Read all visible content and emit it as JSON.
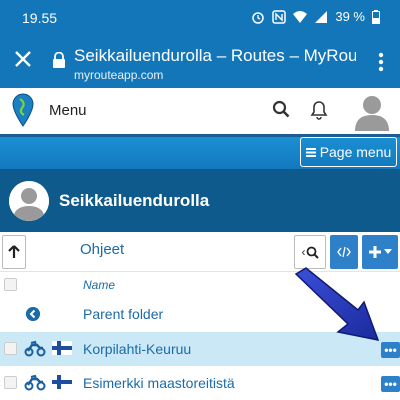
{
  "status_bar": {
    "time": "19.55",
    "battery": "39 %",
    "icons": [
      "alarm-icon",
      "nfc-icon",
      "wifi-icon",
      "signal-icon",
      "battery-icon"
    ]
  },
  "browser": {
    "page_title": "Seikkailuendurolla – Routes – MyRout…",
    "url": "myrouteapp.com"
  },
  "app_header": {
    "menu_label": "Menu"
  },
  "page_menu": {
    "label": "Page menu"
  },
  "profile": {
    "name": "Seikkailuendurolla"
  },
  "toolbar": {
    "label": "Ohjeet",
    "search_prefix": "‹"
  },
  "list": {
    "column_name": "Name",
    "parent_folder": "Parent folder",
    "items": [
      {
        "name": "Korpilahti-Keuruu",
        "selected": true,
        "flag": "finland-flag-icon"
      },
      {
        "name": "Esimerkki maastoreitistä",
        "selected": false,
        "flag": "finland-flag-icon"
      }
    ]
  },
  "colors": {
    "brand_blue": "#1276b8",
    "profile_bg": "#0e5a8c",
    "link_blue": "#1b6ba9",
    "button_blue": "#2e80c8",
    "selected_row": "#cbe8f7"
  }
}
